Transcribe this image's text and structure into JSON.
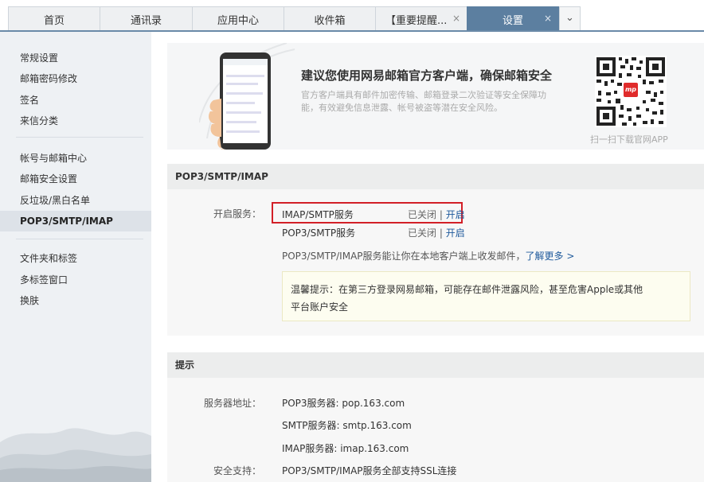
{
  "tabs": [
    {
      "label": "首页"
    },
    {
      "label": "通讯录"
    },
    {
      "label": "应用中心"
    },
    {
      "label": "收件箱"
    },
    {
      "label": "【重要提醒..."
    },
    {
      "label": "设置"
    }
  ],
  "tab_close_glyph": "×",
  "tab_more_glyph": "⌄",
  "sidebar": {
    "group1": [
      "常规设置",
      "邮箱密码修改",
      "签名",
      "来信分类"
    ],
    "group2": [
      "帐号与邮箱中心",
      "邮箱安全设置",
      "反垃圾/黑白名单",
      "POP3/SMTP/IMAP"
    ],
    "group3": [
      "文件夹和标签",
      "多标签窗口",
      "换肤"
    ]
  },
  "banner": {
    "title": "建议您使用网易邮箱官方客户端，确保邮箱安全",
    "desc": "官方客户端具有邮件加密传输、邮箱登录二次验证等安全保障功能，有效避免信息泄露、帐号被盗等潜在安全风险。",
    "qr_caption": "扫一扫下载官网APP",
    "qr_logo": "mp"
  },
  "pop_section": {
    "title": "POP3/SMTP/IMAP",
    "label_open": "开启服务：",
    "services": [
      {
        "name": "IMAP/SMTP服务",
        "status": "已关闭",
        "sep": "|",
        "action": "开启"
      },
      {
        "name": "POP3/SMTP服务",
        "status": "已关闭",
        "sep": "|",
        "action": "开启"
      }
    ],
    "info": "POP3/SMTP/IMAP服务能让你在本地客户端上收发邮件，",
    "more": "了解更多 >",
    "notice_line1": "温馨提示：在第三方登录网易邮箱，可能存在邮件泄露风险，甚至危害Apple或其他",
    "notice_line2": "平台账户安全"
  },
  "tips_section": {
    "title": "提示",
    "label_server": "服务器地址：",
    "pop3": "POP3服务器: pop.163.com",
    "smtp": "SMTP服务器: smtp.163.com",
    "imap": "IMAP服务器: imap.163.com",
    "label_ssl": "安全支持：",
    "ssl": "POP3/SMTP/IMAP服务全部支持SSL连接"
  },
  "colors": {
    "tab_active": "#5c7fa0",
    "highlight_border": "#d21f27",
    "link": "#1f5a9c",
    "qr_logo_bg": "#e02b2b"
  }
}
